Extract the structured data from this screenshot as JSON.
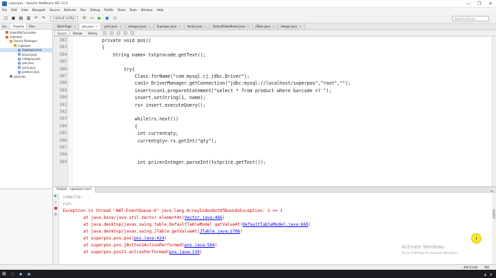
{
  "window": {
    "title": "superpos - Apache NetBeans IDE 12.0",
    "controls": [
      "—",
      "❐",
      "✕"
    ]
  },
  "menu": [
    "File",
    "Edit",
    "View",
    "Navigate",
    "Source",
    "Refactor",
    "Run",
    "Debug",
    "Profile",
    "Team",
    "Tools",
    "Window",
    "Help"
  ],
  "toolbar": {
    "config": "<default config>",
    "search_placeholder": "Search (Ctrl+I)"
  },
  "left_panel": {
    "tabs": [
      "Ser...",
      "Projects",
      "Files"
    ],
    "tree": [
      {
        "label": "ScientificCalculator",
        "indent": 1,
        "icon": "proj"
      },
      {
        "label": "superpos",
        "indent": 1,
        "icon": "proj"
      },
      {
        "label": "Source Packages",
        "indent": 2,
        "icon": "folder"
      },
      {
        "label": "superpos",
        "indent": 3,
        "icon": "folder"
      },
      {
        "label": "Superpos.java",
        "indent": 4,
        "icon": "java",
        "selected": true
      },
      {
        "label": "brand.java",
        "indent": 4,
        "icon": "java"
      },
      {
        "label": "category.java",
        "indent": 4,
        "icon": "java"
      },
      {
        "label": "pos.java",
        "indent": 4,
        "icon": "java"
      },
      {
        "label": "print.java",
        "indent": 4,
        "icon": "java"
      },
      {
        "label": "product.java",
        "indent": 4,
        "icon": "java"
      },
      {
        "label": "Libraries",
        "indent": 2,
        "icon": "lib"
      }
    ]
  },
  "editor_tabs": [
    "Start Page",
    "pos.java",
    "print.java",
    "category.java",
    "Superpos.java",
    "Vector.java",
    "DefaultTableModel.java",
    "JTable.java",
    "Integer.java"
  ],
  "editor_subtabs": [
    "Source",
    "Design",
    "History"
  ],
  "code": [
    {
      "ln": "382",
      "indent": 4,
      "text": "private void pos()"
    },
    {
      "ln": "383",
      "indent": 4,
      "text": "{"
    },
    {
      "ln": "384",
      "indent": 8,
      "text": "String name= txtprocode.getText();"
    },
    {
      "ln": "385",
      "indent": 0,
      "text": ""
    },
    {
      "ln": "386",
      "indent": 12,
      "text": "try{"
    },
    {
      "ln": "387",
      "indent": 16,
      "text": "Class.forName(\"com.mysql.cj.jdbc.Driver\");"
    },
    {
      "ln": "388",
      "indent": 16,
      "text": "con1= DriverManager.getConnection(\"jdbc:mysql://localhost/superpos\",\"root\",\"\");"
    },
    {
      "ln": "389",
      "indent": 16,
      "text": "insert=con1.prepareStatement(\"select * from product where barcode =? \");"
    },
    {
      "ln": "390",
      "indent": 16,
      "text": "insert.setString(1, name);"
    },
    {
      "ln": "391",
      "indent": 16,
      "text": "rs= insert.executeQuery();"
    },
    {
      "ln": "392",
      "indent": 0,
      "text": ""
    },
    {
      "ln": "393",
      "indent": 16,
      "text": "while(rs.next())"
    },
    {
      "ln": "394",
      "indent": 16,
      "text": "{"
    },
    {
      "ln": "395",
      "indent": 17,
      "text": "int currentqty;"
    },
    {
      "ln": "396",
      "indent": 17,
      "text": "currentqty= rs.getInt(\"qty\");"
    },
    {
      "ln": "397",
      "indent": 0,
      "text": ""
    },
    {
      "ln": "398",
      "indent": 0,
      "text": ""
    },
    {
      "ln": "399",
      "indent": 17,
      "text": "int price=Integer.parseInt(txtprice.getText());"
    }
  ],
  "output": {
    "tab": "Output - superpos (run)",
    "lines": [
      {
        "type": "gray",
        "text": "compile:"
      },
      {
        "type": "gray",
        "text": "run:"
      },
      {
        "type": "err",
        "text": "Exception in thread \"AWT-EventQueue-0\" java.lang.ArrayIndexOutOfBoundsException: 1 >= 1"
      },
      {
        "type": "err",
        "indent": 1,
        "text": "at java.base/java.util.Vector.elementAt(",
        "link": "Vector.java:466",
        "after": ")"
      },
      {
        "type": "err",
        "indent": 1,
        "text": "at java.desktop/javax.swing.table.DefaultTableModel.getValueAt(",
        "link": "DefaultTableModel.java:660",
        "after": ")"
      },
      {
        "type": "err",
        "indent": 1,
        "text": "at java.desktop/javax.swing.JTable.getValueAt(",
        "link": "JTable.java:2706",
        "after": ")"
      },
      {
        "type": "err",
        "indent": 1,
        "text": "at superpos.pos.pos(",
        "link": "pos.java:424",
        "after": ")"
      },
      {
        "type": "err",
        "indent": 1,
        "text": "at superpos.pos.jButton1ActionPerformed(",
        "link": "pos.java:564",
        "after": ")"
      },
      {
        "type": "err",
        "indent": 1,
        "text": "at superpos.pos22.actionPerformed(",
        "link": "pos.java:139",
        "after": ")"
      }
    ]
  },
  "watermark": {
    "line1": "Activate Windows",
    "line2": "Go to Settings to activate Windows."
  },
  "status": {
    "position": "406:23:46",
    "mode": "INS"
  },
  "cursor_label": "I"
}
